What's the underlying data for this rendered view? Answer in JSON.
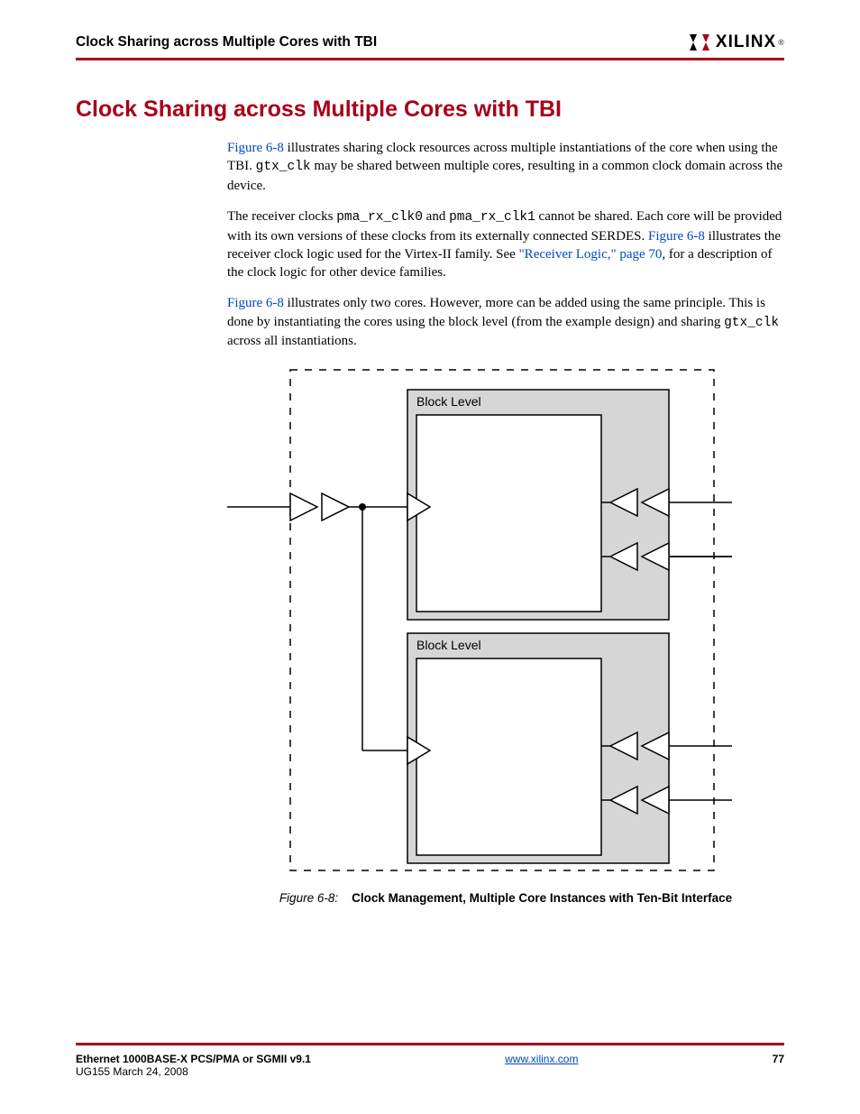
{
  "header": {
    "running_title": "Clock Sharing across Multiple Cores with TBI",
    "logo_text": "XILINX",
    "logo_reg": "®"
  },
  "section": {
    "heading": "Clock Sharing across Multiple Cores with TBI",
    "para1": {
      "link1": "Figure 6-8",
      "t1": " illustrates sharing clock resources across multiple instantiations of the core when using the TBI. ",
      "code1": "gtx_clk",
      "t2": " may be shared between multiple cores, resulting in a common clock domain across the device."
    },
    "para2": {
      "t1": "The receiver clocks ",
      "code1": "pma_rx_clk0",
      "t2": " and ",
      "code2": "pma_rx_clk1",
      "t3": " cannot be shared. Each core will be provided with its own versions of these clocks from its externally connected SERDES. ",
      "link1": "Figure 6-8",
      "t4": " illustrates the receiver clock logic used for the Virtex-II family. See ",
      "link2": "\"Receiver Logic,\" page 70",
      "t5": ", for a description of the clock logic for other device families."
    },
    "para3": {
      "link1": "Figure 6-8",
      "t1": " illustrates only two cores. However, more can be added using the same principle. This is done by instantiating the cores using the block level (from the example design) and sharing ",
      "code1": "gtx_clk",
      "t2": " across all instantiations."
    }
  },
  "figure": {
    "block_label": "Block Level",
    "caption_label": "Figure 6-8:",
    "caption_title": "Clock Management, Multiple Core Instances with Ten-Bit Interface"
  },
  "footer": {
    "doc_title": "Ethernet 1000BASE-X PCS/PMA or SGMII v9.1",
    "doc_id": "UG155 March 24, 2008",
    "url": "www.xilinx.com",
    "page": "77"
  }
}
